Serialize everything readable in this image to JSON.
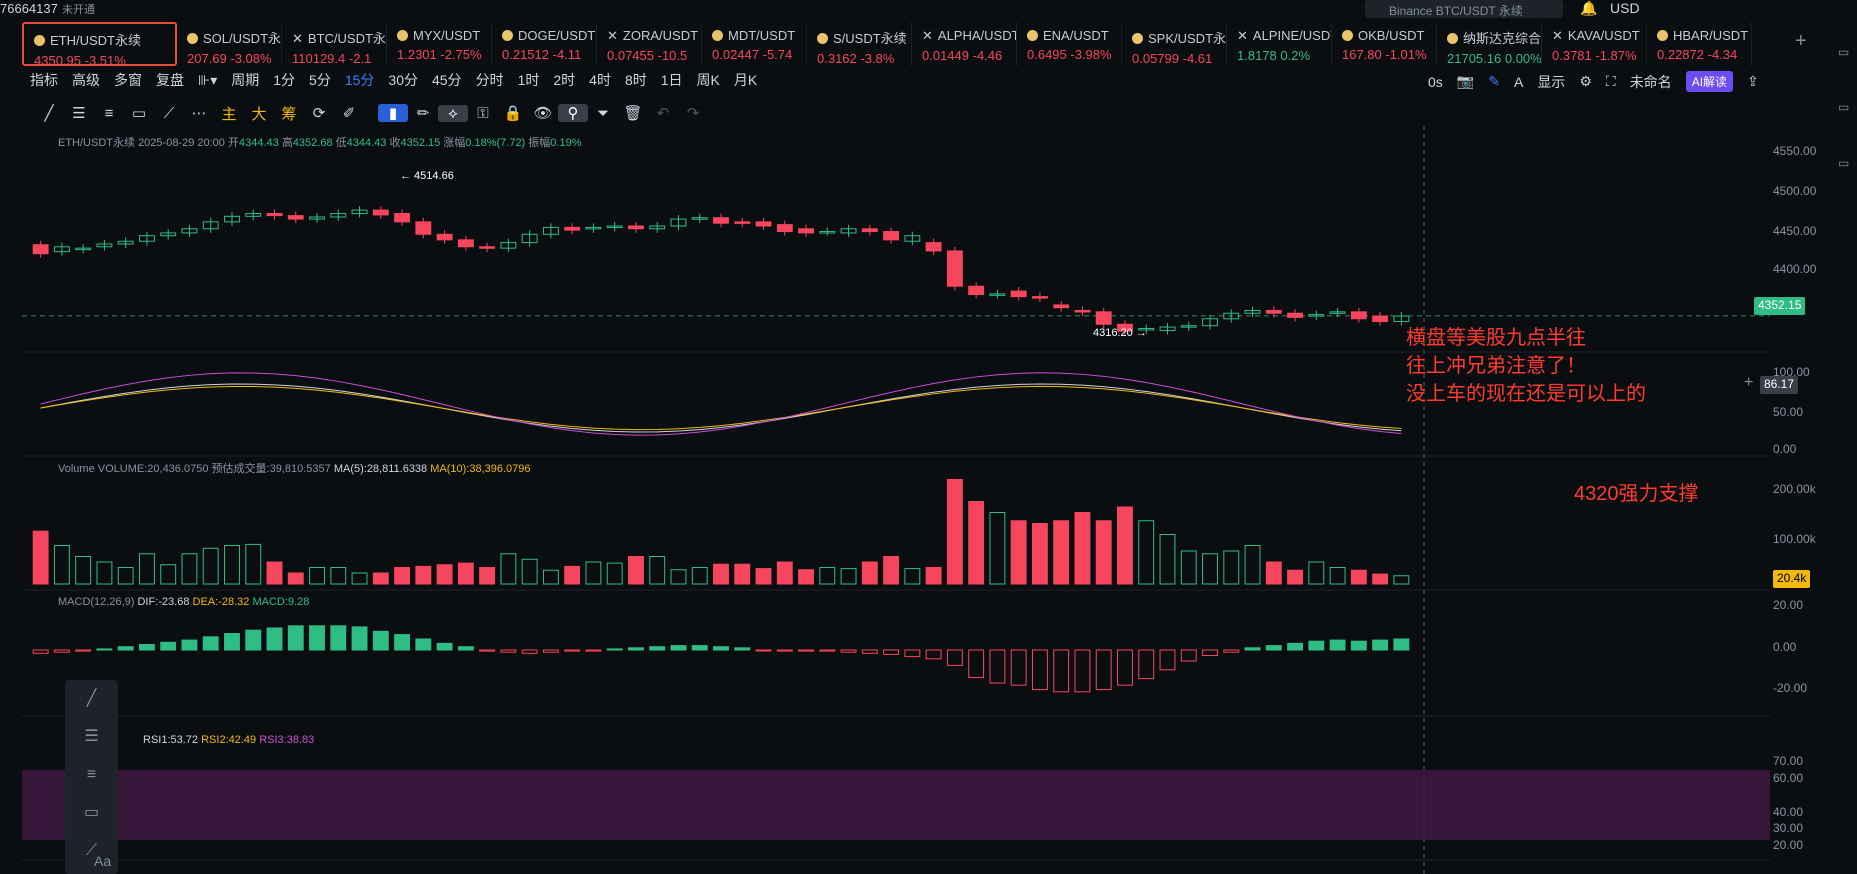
{
  "top": {
    "account": "76664137",
    "status": "未开通",
    "search": "Binance BTC/USDT 永续",
    "currency": "USD"
  },
  "tickers": [
    {
      "name": "ETH/USDT永续",
      "price": "4350.95",
      "change": "-3.51%",
      "dir": "dn",
      "active": true
    },
    {
      "name": "SOL/USDT永",
      "price": "207.69",
      "change": "-3.08%",
      "dir": "dn"
    },
    {
      "name": "BTC/USDT永",
      "price": "110129.4",
      "change": "-2.1",
      "dir": "dn"
    },
    {
      "name": "MYX/USDT",
      "price": "1.2301",
      "change": "-2.75%",
      "dir": "dn"
    },
    {
      "name": "DOGE/USDT",
      "price": "0.21512",
      "change": "-4.11",
      "dir": "dn"
    },
    {
      "name": "ZORA/USDT",
      "price": "0.07455",
      "change": "-10.5",
      "dir": "dn"
    },
    {
      "name": "MDT/USDT",
      "price": "0.02447",
      "change": "-5.74",
      "dir": "dn"
    },
    {
      "name": "S/USDT永续",
      "price": "0.3162",
      "change": "-3.8%",
      "dir": "dn"
    },
    {
      "name": "ALPHA/USDT",
      "price": "0.01449",
      "change": "-4.46",
      "dir": "dn"
    },
    {
      "name": "ENA/USDT",
      "price": "0.6495",
      "change": "-3.98%",
      "dir": "dn"
    },
    {
      "name": "SPK/USDT永",
      "price": "0.05799",
      "change": "-4.61",
      "dir": "dn"
    },
    {
      "name": "ALPINE/USDT",
      "price": "1.8178",
      "change": "0.2%",
      "dir": "up"
    },
    {
      "name": "OKB/USDT",
      "price": "167.80",
      "change": "-1.01%",
      "dir": "dn"
    },
    {
      "name": "纳斯达克综合指数",
      "price": "21705.16",
      "change": "0.00%",
      "dir": "up"
    },
    {
      "name": "KAVA/USDT",
      "price": "0.3781",
      "change": "-1.87%",
      "dir": "dn"
    },
    {
      "name": "HBAR/USDT",
      "price": "0.22872",
      "change": "-4.34",
      "dir": "dn"
    }
  ],
  "toolbar": {
    "indicator": "指标",
    "advanced": "高级",
    "multiwindow": "多窗",
    "replay": "复盘",
    "period": "周期",
    "intervals": [
      "1分",
      "5分",
      "15分",
      "30分",
      "45分",
      "分时",
      "1时",
      "2时",
      "4时",
      "8时",
      "1日",
      "周K",
      "月K"
    ],
    "selected": "15分",
    "zero_s": "0s",
    "display": "显示",
    "unnamed": "未命名",
    "ai": "AI解读"
  },
  "drawtools": {
    "main": "主",
    "big": "大",
    "chips": "筹"
  },
  "main_chart": {
    "symbol": "ETH/USDT永续",
    "date": "2025-08-29 20:00",
    "open_label": "开",
    "open": "4344.43",
    "high_label": "高",
    "high": "4352.68",
    "low_label": "低",
    "low": "4344.43",
    "close_label": "收",
    "close": "4352.15",
    "chg_label": "涨幅",
    "chg": "0.18%(7.72)",
    "amp_label": "振幅",
    "amp": "0.19%",
    "high_marker": "← 4514.66",
    "low_marker": "4316.20 →",
    "last": "4352.15",
    "ticks": [
      "4550.00",
      "4500.00",
      "4450.00",
      "4400.00"
    ]
  },
  "kdj": {
    "ticks": [
      "100.00",
      "50.00",
      "0.00"
    ],
    "cursor": "86.17"
  },
  "volume": {
    "label": "Volume",
    "vol": "VOLUME:20,436.0750",
    "forecast": "预估成交量:39,810.5357",
    "ma5": "MA(5):28,811.6338",
    "ma10": "MA(10):38,396.0796",
    "ticks": [
      "200.00k",
      "100.00k"
    ],
    "last": "20.4k"
  },
  "macd": {
    "label": "MACD(12,26,9)",
    "dif": "DIF:-23.68",
    "dea": "DEA:-28.32",
    "macd": "MACD:9.28",
    "ticks": [
      "20.00",
      "0.00",
      "-20.00"
    ]
  },
  "rsi": {
    "rsi1": "RSI1:53.72",
    "rsi2": "RSI2:42.49",
    "rsi3": "RSI3:38.83",
    "ticks": [
      "70.00",
      "60.00",
      "40.00",
      "30.00",
      "20.00"
    ]
  },
  "annotations": {
    "line1": "横盘等美股九点半往",
    "line2": "往上冲兄弟注意了！",
    "line3": "没上车的现在还是可以上的",
    "support": "4320强力支撑"
  },
  "sidebar_tools": [
    "draw-line",
    "fib",
    "parallel",
    "rect",
    "ray",
    "Aa"
  ],
  "colors": {
    "up": "#2ebd85",
    "down": "#f6465d",
    "accent": "#3d7eff",
    "annot": "#ff3b30"
  },
  "chart_data": {
    "type": "candlestick",
    "main": {
      "opens": [
        4455,
        4445,
        4448,
        4452,
        4456,
        4460,
        4468,
        4472,
        4478,
        4488,
        4496,
        4500,
        4497,
        4492,
        4495,
        4500,
        4505,
        4500,
        4488,
        4470,
        4462,
        4452,
        4450,
        4458,
        4470,
        4480,
        4478,
        4480,
        4482,
        4478,
        4482,
        4492,
        4494,
        4488,
        4488,
        4484,
        4478,
        4474,
        4472,
        4478,
        4474,
        4460,
        4458,
        4446,
        4395,
        4383,
        4388,
        4380,
        4368,
        4360,
        4358,
        4340,
        4332,
        4331,
        4336,
        4338,
        4348,
        4356,
        4360,
        4356,
        4352,
        4356,
        4358,
        4352,
        4344
      ],
      "closes": [
        4442,
        4452,
        4450,
        4456,
        4460,
        4468,
        4472,
        4478,
        4488,
        4496,
        4500,
        4497,
        4492,
        4495,
        4500,
        4505,
        4498,
        4488,
        4470,
        4462,
        4452,
        4450,
        4458,
        4470,
        4480,
        4476,
        4480,
        4482,
        4478,
        4482,
        4492,
        4494,
        4486,
        4486,
        4482,
        4474,
        4472,
        4474,
        4478,
        4474,
        4462,
        4468,
        4446,
        4395,
        4383,
        4384,
        4380,
        4378,
        4364,
        4358,
        4340,
        4330,
        4334,
        4336,
        4338,
        4348,
        4356,
        4360,
        4356,
        4350,
        4354,
        4358,
        4348,
        4344,
        4352
      ]
    },
    "volume": [
      96,
      70,
      50,
      40,
      30,
      55,
      35,
      55,
      65,
      70,
      72,
      40,
      20,
      30,
      30,
      20,
      20,
      30,
      32,
      35,
      38,
      30,
      55,
      45,
      25,
      32,
      40,
      38,
      50,
      50,
      26,
      30,
      36,
      36,
      28,
      40,
      26,
      30,
      28,
      40,
      50,
      28,
      30,
      190,
      150,
      130,
      115,
      110,
      115,
      130,
      115,
      140,
      115,
      90,
      60,
      55,
      60,
      70,
      40,
      25,
      40,
      30,
      25,
      18,
      15
    ],
    "macd_hist": [
      -3,
      -2,
      -1,
      1,
      3,
      5,
      7,
      9,
      12,
      15,
      18,
      20,
      22,
      22,
      22,
      21,
      17,
      14,
      10,
      6,
      3,
      -1,
      -2,
      -3,
      -2,
      -1,
      -1,
      1,
      2,
      3,
      4,
      4,
      3,
      2,
      0,
      -1,
      -1,
      -1,
      -2,
      -3,
      -4,
      -6,
      -8,
      -14,
      -25,
      -30,
      -32,
      -36,
      -38,
      -38,
      -36,
      -32,
      -26,
      -18,
      -10,
      -5,
      -2,
      2,
      4,
      6,
      8,
      9,
      8,
      9,
      10
    ]
  }
}
